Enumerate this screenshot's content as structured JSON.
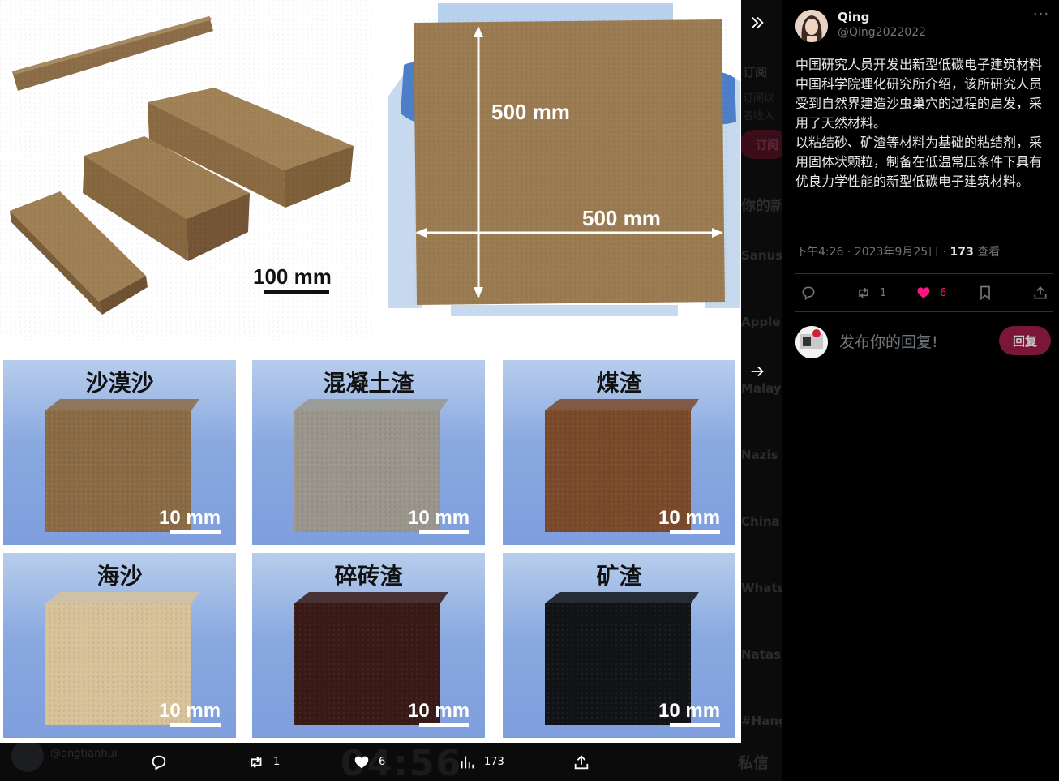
{
  "media": {
    "top_photos": {
      "small_bricks_scale": "100 mm",
      "panel_height": "500 mm",
      "panel_width": "500 mm"
    },
    "samples": [
      {
        "label": "沙漠沙",
        "scale": "10 mm",
        "color": "#8a6b45"
      },
      {
        "label": "混凝土渣",
        "scale": "10 mm",
        "color": "#9a968c"
      },
      {
        "label": "煤渣",
        "scale": "10 mm",
        "color": "#7a4a2a"
      },
      {
        "label": "海沙",
        "scale": "10 mm",
        "color": "#d8c29a"
      },
      {
        "label": "碎砖渣",
        "scale": "10 mm",
        "color": "#3a1a16"
      },
      {
        "label": "矿渣",
        "scale": "10 mm",
        "color": "#111317"
      }
    ]
  },
  "media_toolbar": {
    "retweets": "1",
    "likes": "6",
    "views": "173"
  },
  "background": {
    "words": [
      "订阅",
      "订阅以",
      "者收入",
      "订阅",
      "你的新",
      "Sanusi",
      "Apple",
      "Malays",
      "Nazis",
      "China",
      "Whats",
      "Natash",
      "#Hang"
    ],
    "messages_label": "私信",
    "clock": "04:56",
    "handle": "@ongtianhui"
  },
  "tweet": {
    "author_name": "Qing",
    "author_handle": "@Qing2022022",
    "paragraphs": [
      "中国研究人员开发出新型低碳电子建筑材料",
      "中国科学院理化研究所介绍，该所研究人员受到自然界建造沙虫巢穴的过程的启发，采用了天然材料。",
      "以粘结砂、矿渣等材料为基础的粘结剂，采用固体状颗粒，制备在低温常压条件下具有优良力学性能的新型低碳电子建筑材料。"
    ],
    "time": "下午4:26",
    "date": "2023年9月25日",
    "views": "173",
    "views_label": "查看",
    "retweets": "1",
    "likes": "6"
  },
  "reply": {
    "placeholder": "发布你的回复!",
    "button": "回复"
  },
  "colors": {
    "accent_like": "#f91880",
    "reply_button": "#7a1638"
  }
}
